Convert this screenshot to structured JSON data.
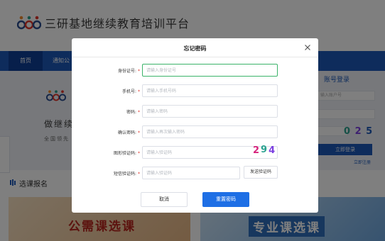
{
  "site": {
    "title": "三研基地继续教育培训平台"
  },
  "nav": {
    "home": "首页",
    "notice": "通知公"
  },
  "hero": {
    "title": "做继续",
    "subtitle": "全国领先"
  },
  "login_panel": {
    "tab_label": "账号登录",
    "account_placeholder": "输入账户号",
    "captcha": "0 2 5",
    "login_button": "立即登录",
    "register_link": "立即注册"
  },
  "section": {
    "title": "选课报名"
  },
  "cards": {
    "public": "公需课选课",
    "professional": "专业课选课"
  },
  "modal": {
    "title": "忘记密码",
    "fields": [
      {
        "label": "身份证号:",
        "required": "*",
        "placeholder": "请输入身份证号",
        "value": ""
      },
      {
        "label": "手机号:",
        "required": "*",
        "placeholder": "请输入手机号码",
        "value": ""
      },
      {
        "label": "密码:",
        "required": "*",
        "placeholder": "请输入密码",
        "value": ""
      },
      {
        "label": "确认密码:",
        "required": "*",
        "placeholder": "请输入再次输入密码",
        "value": ""
      },
      {
        "label": "图形验证码:",
        "required": "*",
        "placeholder": "请输入验证码",
        "value": ""
      },
      {
        "label": "短信验证码:",
        "required": "*",
        "placeholder": "请输入验证码",
        "value": ""
      }
    ],
    "captcha_chars": [
      "2",
      "9",
      "4"
    ],
    "send_code_button": "发送验证码",
    "cancel_button": "取消",
    "reset_button": "重置密码"
  },
  "colors": {
    "brand_blue": "#1d58b8",
    "primary_button": "#1e6fe5",
    "required_star": "#e0352b",
    "focus_green": "#3bb36a",
    "captcha_digit_1": "#d6247d",
    "captcha_digit_2": "#2aa18f",
    "captcha_digit_3": "#7b3fe0"
  },
  "icons": {
    "close": "close-icon",
    "logo": "logo-icon",
    "section": "list-icon"
  }
}
